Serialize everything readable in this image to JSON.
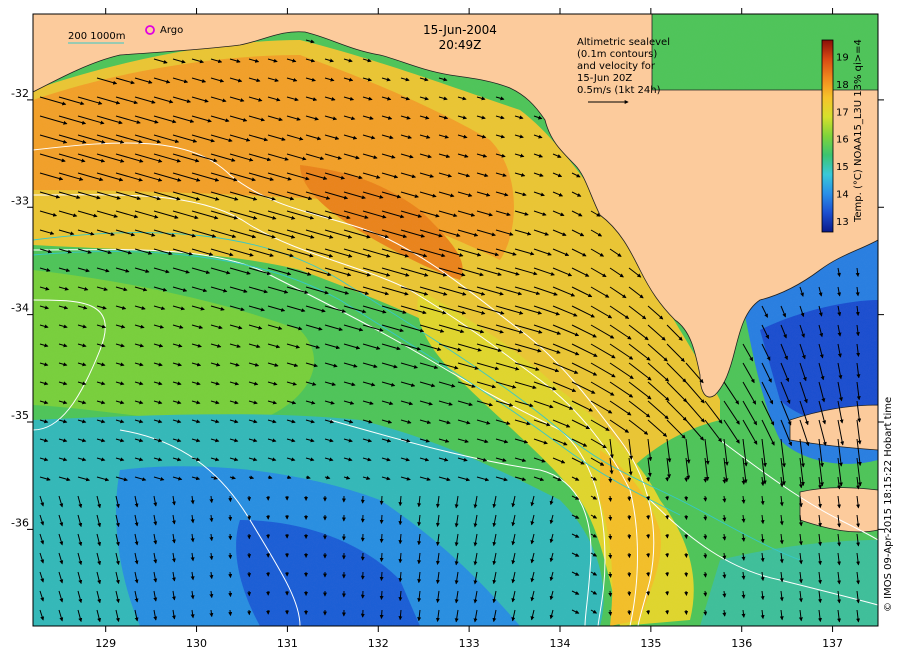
{
  "title": {
    "date": "15-Jun-2004",
    "time": "20:49Z"
  },
  "legend": {
    "isobath_label": "200  1000m",
    "argo_label": "Argo"
  },
  "annotation": {
    "lines": [
      "Altimetric sealevel",
      "(0.1m contours)",
      "and velocity for",
      "15-Jun 20Z",
      "0.5m/s (1kt 24h)"
    ]
  },
  "axes": {
    "lon_ticks": [
      "129",
      "130",
      "131",
      "132",
      "133",
      "134",
      "135",
      "136",
      "137"
    ],
    "lat_ticks": [
      "-32",
      "-33",
      "-34",
      "-35",
      "-36"
    ],
    "lon_range": [
      128.2,
      137.5
    ],
    "lat_range": [
      -36.9,
      -31.2
    ]
  },
  "colorbar": {
    "label": "Temp. (°C) NOAA15_L3U 13% qi>=4",
    "ticks": [
      "19",
      "18",
      "17",
      "16",
      "15",
      "14",
      "13"
    ],
    "range": [
      12.6,
      19.6
    ],
    "colors": [
      "#0a1a8a",
      "#1c4fd0",
      "#2a90e8",
      "#39c9d8",
      "#3cc470",
      "#7fd43a",
      "#d6e02c",
      "#f7c32a",
      "#f08a1e",
      "#d94a14",
      "#8a0f08"
    ]
  },
  "credit": "© IMOS 09-Apr-2015 18:15:22 Hobart time",
  "colors": {
    "land": "#fccb9c",
    "contour": "#ffffff",
    "isobath": "#36c8c8",
    "argo": "#e000e0",
    "arrow": "#000000"
  }
}
